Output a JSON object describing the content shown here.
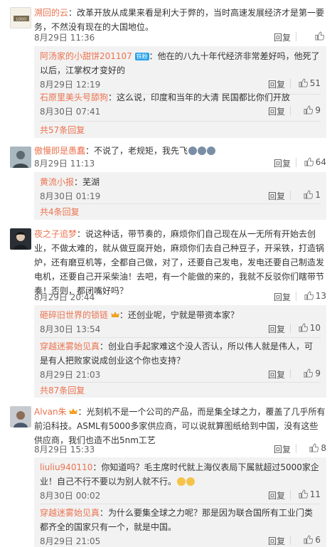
{
  "comments": [
    {
      "user": "溯回的云",
      "text": "：改革开放从成果来看是利大于弊的，当时高速发展经济才是第一要务，不然没有现在的大国地位。",
      "time": "8月29日 11:36",
      "reply": "回复",
      "likes": "",
      "replies": [
        {
          "user": "阿汤家的小甜饼201107",
          "badge": "铁粉",
          "text": "：他在的八九十年代经济非常差好吗，他死了以后，江掌权才变好的",
          "time": "8月29日 12:19",
          "reply": "回复",
          "likes": "51"
        },
        {
          "user": "石原里美头号舔狗",
          "text": "：这么说，印度和当年的大清 民国都比你们开放",
          "time": "8月30日 07:41",
          "reply": "回复",
          "likes": "9"
        }
      ],
      "more": "共57条回复"
    },
    {
      "user": "傲慢即是愚蠢",
      "text": "：不说了，老规矩，我先飞",
      "time": "8月29日 11:13",
      "reply": "回复",
      "likes": "64",
      "replies": [
        {
          "user": "黄流小报",
          "text": "：芜湖",
          "time": "8月30日 01:19",
          "reply": "回复",
          "likes": "1"
        }
      ],
      "more": "共4条回复"
    },
    {
      "user": "夜之子追梦",
      "text": "：说这种话，带节奏的，麻烦你们自己现在从一无所有开始去创业，不做太难的，就从做豆腐开始，麻烦你们去自己种豆子，开采铁，打造锅炉，还有磨豆机等，全都自己做，对了，还要自己发电，发电还要自己制造发电机，还要自己开采柴油！去吧，有一个能做的来的，我就不反驳你们瞎带节奏！否则，都闭嘴好吗？",
      "time": "8月29日 20:44",
      "reply": "回复",
      "likes": "13",
      "replies": [
        {
          "user": "砸碎旧世界的锁链",
          "text": "：还创业呢，宁就是带资本家？",
          "time": "8月30日 13:54",
          "reply": "回复",
          "likes": "10"
        },
        {
          "user": "穿越迷雾始见真",
          "text": "：创业白手起家难这个没人否认，所以伟人就是伟人，可是有人把败家说成创业这个你也支持？",
          "time": "8月29日 21:03",
          "reply": "回复",
          "likes": "9"
        }
      ],
      "more": "共87条回复"
    },
    {
      "user": "Alvan朱",
      "text": "：光刻机不是一个公司的产品，而是集全球之力，覆盖了几乎所有前沿科技。ASML有5000多家供应商，可以说就算图纸给到中国，没有这些供应商，我们也造不出5nm工艺",
      "time": "8月29日 15:33",
      "reply": "回复",
      "likes": "8",
      "replies": [
        {
          "user": "liuliu940110",
          "text": "：你知道吗？毛主席时代就上海仪表局下属就超过5000家企业！自己不行不要以为别人就不行。",
          "time": "8月30日 00:02",
          "reply": "回复",
          "likes": "11"
        },
        {
          "user": "穿越迷雾始见真",
          "text": "：为什么要集全球之力呢？那是因为联合国所有工业门类都齐全的国家只有一个，就是中国。",
          "time": "8月29日 21:05",
          "reply": "回复",
          "likes": "6"
        }
      ]
    }
  ],
  "colors": {
    "name": "#eb7350",
    "reply_bg": "#f2f2f2",
    "text": "#333333",
    "meta": "#666666"
  },
  "icons": {
    "like": "thumb-up-icon"
  }
}
